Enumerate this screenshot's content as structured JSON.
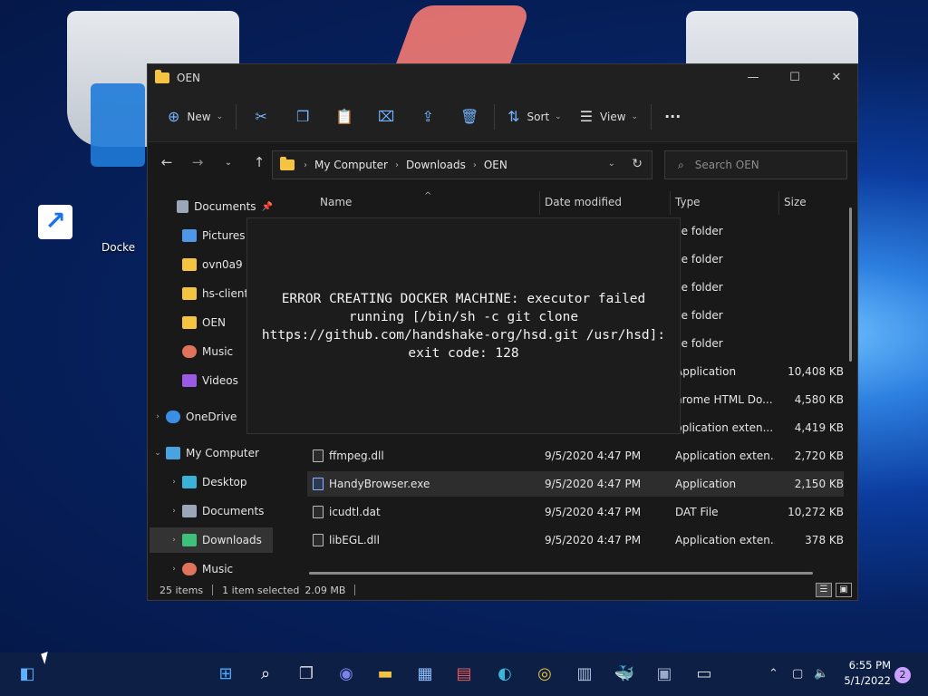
{
  "desktop": {
    "shortcut_label": "Docke"
  },
  "window": {
    "title": "OEN",
    "controls": {
      "minimize": "—",
      "maximize": "☐",
      "close": "✕"
    }
  },
  "toolbar": {
    "new_label": "New",
    "sort_label": "Sort",
    "view_label": "View",
    "more": "···"
  },
  "address": {
    "crumbs": [
      "My Computer",
      "Downloads",
      "OEN"
    ]
  },
  "search": {
    "placeholder": "Search OEN"
  },
  "sidebar": {
    "items": [
      {
        "label": "Documents",
        "icon": "documents-icon",
        "pinned": true
      },
      {
        "label": "Pictures",
        "icon": "pictures-icon"
      },
      {
        "label": "ovn0a9",
        "icon": "folder-icon"
      },
      {
        "label": "hs-client-",
        "icon": "folder-icon"
      },
      {
        "label": "OEN",
        "icon": "folder-icon"
      },
      {
        "label": "Music",
        "icon": "music-icon"
      },
      {
        "label": "Videos",
        "icon": "videos-icon"
      },
      {
        "label": "OneDrive",
        "icon": "onedrive-icon"
      },
      {
        "label": "My Computer",
        "icon": "computer-icon"
      },
      {
        "label": "Desktop",
        "icon": "desktop-icon"
      },
      {
        "label": "Documents",
        "icon": "documents-icon"
      },
      {
        "label": "Downloads",
        "icon": "downloads-icon",
        "selected": true
      },
      {
        "label": "Music",
        "icon": "music-icon"
      }
    ]
  },
  "columns": {
    "name": "Name",
    "date": "Date modified",
    "type": "Type",
    "size": "Size"
  },
  "files": [
    {
      "name": "",
      "date": "",
      "type": "ile folder",
      "size": ""
    },
    {
      "name": "",
      "date": "",
      "type": "ile folder",
      "size": ""
    },
    {
      "name": "",
      "date": "",
      "type": "ile folder",
      "size": ""
    },
    {
      "name": "",
      "date": "",
      "type": "ile folder",
      "size": ""
    },
    {
      "name": "",
      "date": "",
      "type": "ile folder",
      "size": ""
    },
    {
      "name": "",
      "date": "",
      "type": "Application",
      "size": "10,408 KB"
    },
    {
      "name": "",
      "date": "",
      "type": "hrome HTML Do...",
      "size": "4,580 KB"
    },
    {
      "name": "",
      "date": "",
      "type": "pplication exten...",
      "size": "4,419 KB"
    },
    {
      "name": "ffmpeg.dll",
      "date": "9/5/2020 4:47 PM",
      "type": "Application exten...",
      "size": "2,720 KB"
    },
    {
      "name": "HandyBrowser.exe",
      "date": "9/5/2020 4:47 PM",
      "type": "Application",
      "size": "2,150 KB"
    },
    {
      "name": "icudtl.dat",
      "date": "9/5/2020 4:47 PM",
      "type": "DAT File",
      "size": "10,272 KB"
    },
    {
      "name": "libEGL.dll",
      "date": "9/5/2020 4:47 PM",
      "type": "Application exten...",
      "size": "378 KB"
    }
  ],
  "status": {
    "count": "25 items",
    "selected": "1 item selected",
    "size": "2.09 MB"
  },
  "error": {
    "message": "ERROR CREATING DOCKER MACHINE: executor failed running [/bin/sh -c git clone https://github.com/handshake-org/hsd.git /usr/hsd]: exit code: 128"
  },
  "taskbar": {
    "time": "6:55 PM",
    "date": "5/1/2022",
    "notifications": "2"
  }
}
